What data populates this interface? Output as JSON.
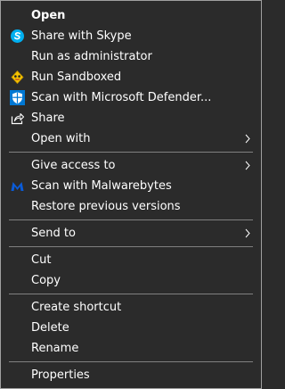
{
  "menu": {
    "open": "Open",
    "skype": "Share with Skype",
    "run_admin": "Run as administrator",
    "sandbox": "Run Sandboxed",
    "defender": "Scan with Microsoft Defender...",
    "share": "Share",
    "open_with": "Open with",
    "give_access": "Give access to",
    "malwarebytes": "Scan with Malwarebytes",
    "restore": "Restore previous versions",
    "send_to": "Send to",
    "cut": "Cut",
    "copy": "Copy",
    "create_shortcut": "Create shortcut",
    "delete": "Delete",
    "rename": "Rename",
    "properties": "Properties"
  },
  "icons": {
    "skype": "skype-icon",
    "sandbox": "sandboxie-icon",
    "defender": "defender-shield-icon",
    "share": "share-icon",
    "malwarebytes": "malwarebytes-icon",
    "submenu": "chevron-right-icon"
  },
  "colors": {
    "background": "#2b2b2b",
    "text": "#ffffff",
    "separator": "#808080",
    "border": "#a0a0a0",
    "skype": "#00aff0",
    "defender": "#0078d4",
    "malwarebytes": "#0a5bd8",
    "sandbox": "#f5c400"
  }
}
